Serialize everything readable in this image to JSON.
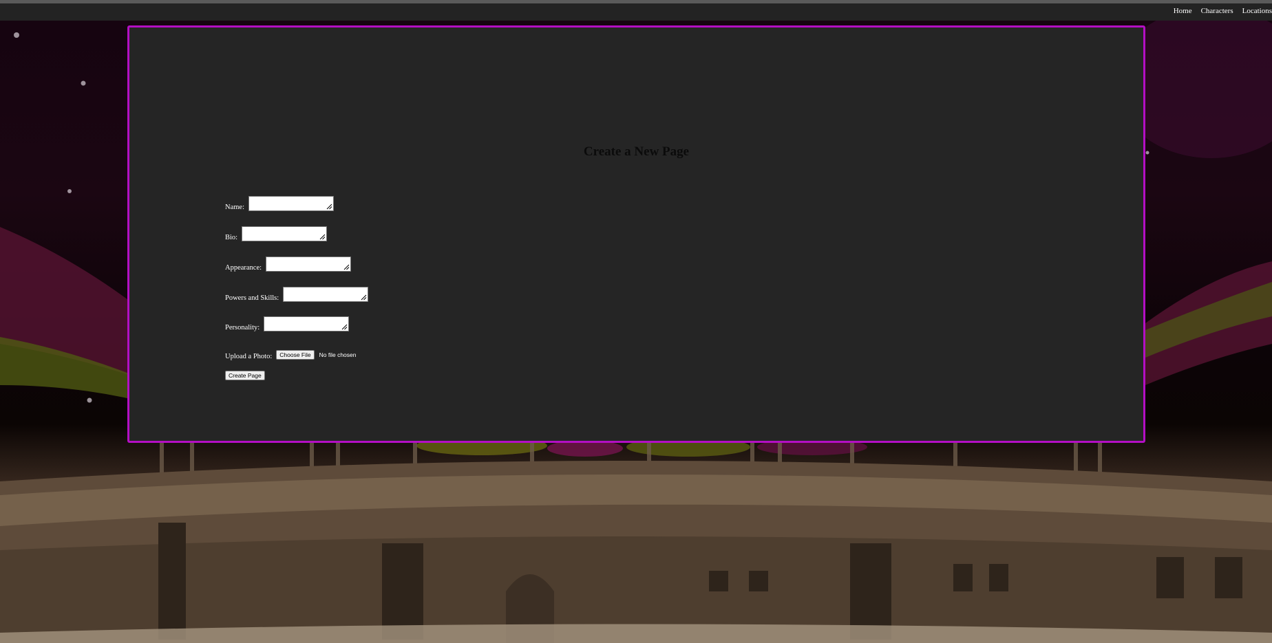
{
  "nav": {
    "items": [
      {
        "label": "Home"
      },
      {
        "label": "Characters"
      },
      {
        "label": "Locations"
      }
    ]
  },
  "page": {
    "title": "Create a New Page"
  },
  "form": {
    "fields": [
      {
        "label": "Name:",
        "value": ""
      },
      {
        "label": "Bio:",
        "value": ""
      },
      {
        "label": "Appearance:",
        "value": ""
      },
      {
        "label": "Powers and Skills:",
        "value": ""
      },
      {
        "label": "Personality:",
        "value": ""
      }
    ],
    "upload": {
      "label": "Upload a Photo:",
      "button_label": "Choose File",
      "status": "No file chosen"
    },
    "submit_label": "Create Page"
  },
  "colors": {
    "panel_border": "#b40fc4",
    "panel_background": "#252525",
    "topbar_background": "#232323"
  }
}
